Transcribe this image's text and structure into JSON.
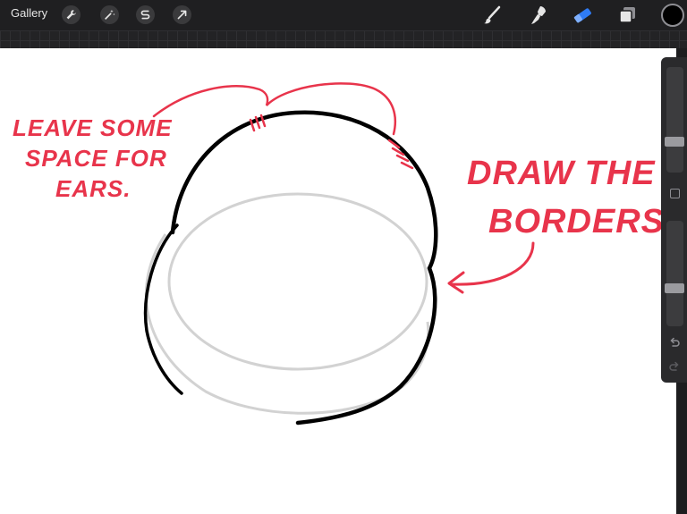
{
  "toolbar": {
    "gallery_label": "Gallery",
    "left_tools": [
      "wrench-icon",
      "magic-wand-icon",
      "selection-s-icon",
      "arrow-cursor-icon"
    ],
    "right_tools": [
      "brush-icon",
      "smudge-icon",
      "eraser-icon",
      "layers-icon"
    ],
    "active_tool": "eraser-icon",
    "active_color": "#000000"
  },
  "sidebar": {
    "brush_size_level": 0.27,
    "opacity_level": 0.35
  },
  "annotations": {
    "left_note": [
      "LEAVE SOME",
      "SPACE FOR",
      "EARS."
    ],
    "right_note": [
      "DRAW THE",
      "BORDERS"
    ]
  },
  "colors": {
    "annotation": "#e8344b",
    "accent_blue": "#2f7cf6"
  }
}
